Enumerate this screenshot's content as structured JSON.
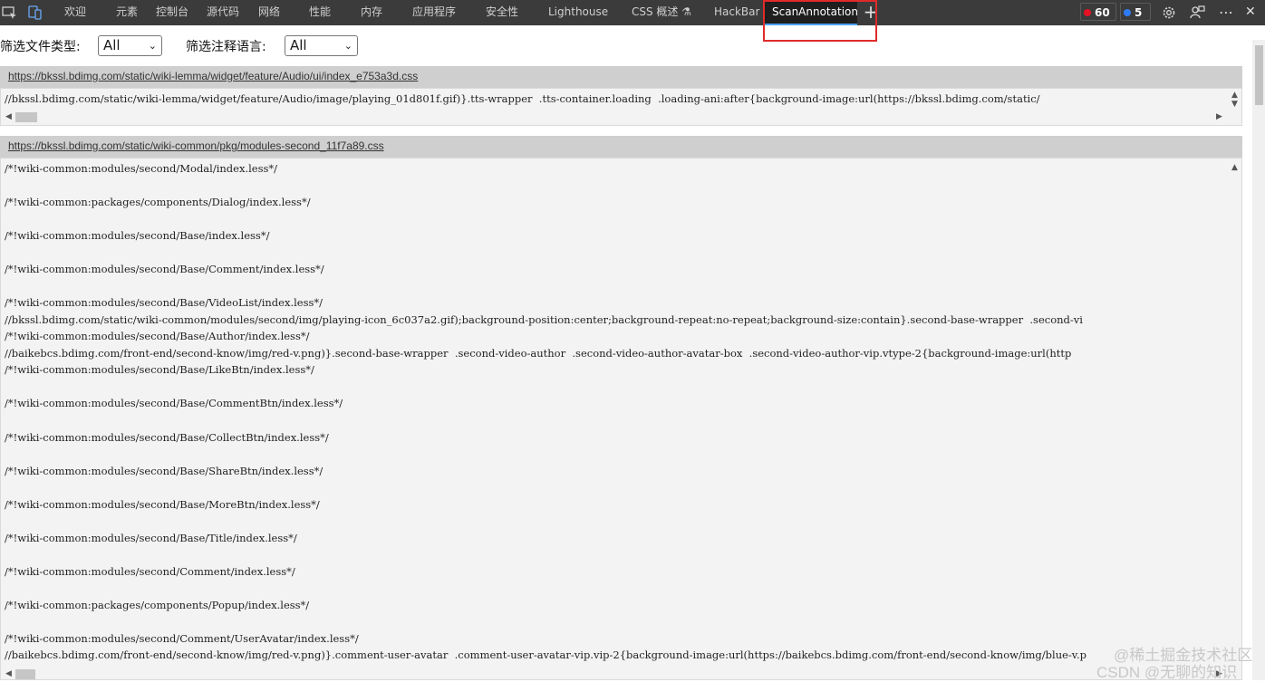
{
  "tabbar": {
    "tabs": [
      {
        "label": "欢迎"
      },
      {
        "label": "元素"
      },
      {
        "label": "控制台"
      },
      {
        "label": "源代码"
      },
      {
        "label": "网络"
      },
      {
        "label": "性能"
      },
      {
        "label": "内存"
      },
      {
        "label": "应用程序"
      },
      {
        "label": "安全性"
      },
      {
        "label": "Lighthouse"
      },
      {
        "label": "CSS 概述 ⚗"
      },
      {
        "label": "HackBar"
      },
      {
        "label": "ScanAnnotation"
      }
    ],
    "add_tab": "+",
    "errors_count": "60",
    "issues_count": "5",
    "more": "⋯",
    "close": "✕"
  },
  "filters": {
    "file_type_label": "筛选文件类型:",
    "file_type_value": "All",
    "lang_label": "筛选注释语言:",
    "lang_value": "All"
  },
  "files": [
    {
      "url": "https://bkssl.bdimg.com/static/wiki-lemma/widget/feature/Audio/ui/index_e753a3d.css",
      "lines": [
        "//bkssl.bdimg.com/static/wiki-lemma/widget/feature/Audio/image/playing_01d801f.gif)}.tts-wrapper  .tts-container.loading  .loading-ani:after{background-image:url(https://bkssl.bdimg.com/static/"
      ]
    },
    {
      "url": "https://bkssl.bdimg.com/static/wiki-common/pkg/modules-second_11f7a89.css",
      "lines": [
        "/*!wiki-common:modules/second/Modal/index.less*/",
        "",
        "/*!wiki-common:packages/components/Dialog/index.less*/",
        "",
        "/*!wiki-common:modules/second/Base/index.less*/",
        "",
        "/*!wiki-common:modules/second/Base/Comment/index.less*/",
        "",
        "/*!wiki-common:modules/second/Base/VideoList/index.less*/",
        "//bkssl.bdimg.com/static/wiki-common/modules/second/img/playing-icon_6c037a2.gif);background-position:center;background-repeat:no-repeat;background-size:contain}.second-base-wrapper  .second-vi",
        "/*!wiki-common:modules/second/Base/Author/index.less*/",
        "//baikebcs.bdimg.com/front-end/second-know/img/red-v.png)}.second-base-wrapper  .second-video-author  .second-video-author-avatar-box  .second-video-author-vip.vtype-2{background-image:url(http",
        "/*!wiki-common:modules/second/Base/LikeBtn/index.less*/",
        "",
        "/*!wiki-common:modules/second/Base/CommentBtn/index.less*/",
        "",
        "/*!wiki-common:modules/second/Base/CollectBtn/index.less*/",
        "",
        "/*!wiki-common:modules/second/Base/ShareBtn/index.less*/",
        "",
        "/*!wiki-common:modules/second/Base/MoreBtn/index.less*/",
        "",
        "/*!wiki-common:modules/second/Base/Title/index.less*/",
        "",
        "/*!wiki-common:modules/second/Comment/index.less*/",
        "",
        "/*!wiki-common:packages/components/Popup/index.less*/",
        "",
        "/*!wiki-common:modules/second/Comment/UserAvatar/index.less*/",
        "//baikebcs.bdimg.com/front-end/second-know/img/red-v.png)}.comment-user-avatar  .comment-user-avatar-vip.vip-2{background-image:url(https://baikebcs.bdimg.com/front-end/second-know/img/blue-v.p"
      ]
    }
  ],
  "watermark": {
    "line1": "@稀土掘金技术社区",
    "line2": "CSDN @无聊的知识"
  },
  "colors": {
    "tabbar_bg": "#3b3b3b",
    "active_tab_bg": "#1f1f1f",
    "highlight_box": "#e02a2a",
    "error_dot": "#e81123",
    "issue_dot": "#2f7bf5",
    "panel_header": "#cfcfcf",
    "panel_bg": "#f3f3f3"
  }
}
